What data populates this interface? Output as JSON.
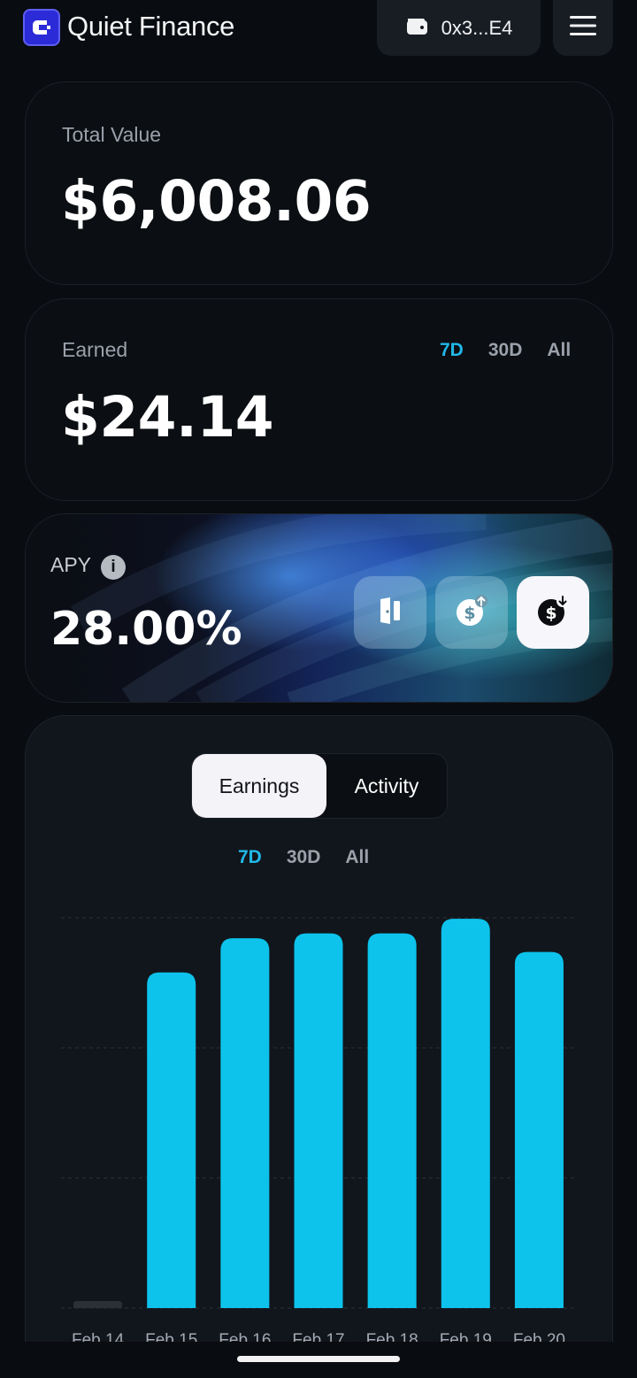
{
  "header": {
    "brand": "Quiet Finance",
    "wallet_address": "0x3...E4",
    "icons": [
      "logo-mark",
      "wallet-icon",
      "hamburger-menu-icon"
    ]
  },
  "total_value": {
    "label": "Total Value",
    "value": "$6,008.06"
  },
  "earned": {
    "label": "Earned",
    "value": "$24.14",
    "ranges": [
      "7D",
      "30D",
      "All"
    ],
    "active_range": "7D"
  },
  "apy": {
    "label": "APY",
    "value": "28.00%",
    "actions": [
      "door-icon",
      "deposit-dollar-icon",
      "withdraw-dollar-icon"
    ]
  },
  "chart_panel": {
    "tabs": [
      "Earnings",
      "Activity"
    ],
    "active_tab": "Earnings",
    "ranges": [
      "7D",
      "30D",
      "All"
    ],
    "active_range": "7D"
  },
  "colors": {
    "accent": "#21b8e8",
    "bar": "#0dc3ec",
    "empty_bar": "#2a3038",
    "background": "#090c10"
  },
  "chart_data": {
    "type": "bar",
    "categories": [
      "Feb 14",
      "Feb 15",
      "Feb 16",
      "Feb 17",
      "Feb 18",
      "Feb 19",
      "Feb 20"
    ],
    "values": [
      0,
      3.44,
      3.79,
      3.84,
      3.84,
      3.99,
      3.65
    ],
    "ylim": [
      0,
      4
    ],
    "grid": true,
    "yticks_visible": false,
    "title": "",
    "xlabel": "",
    "ylabel": ""
  }
}
